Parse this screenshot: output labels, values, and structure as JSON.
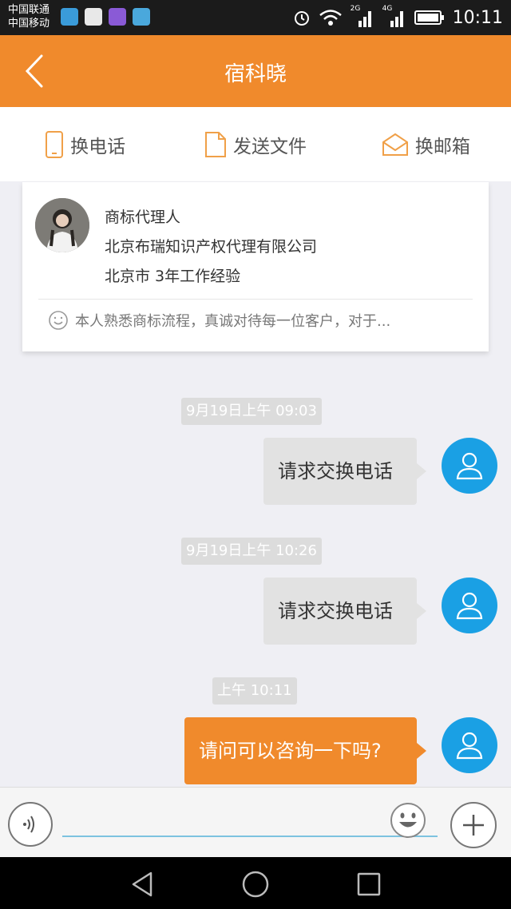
{
  "status_bar": {
    "carrier_1": "中国联通",
    "carrier_2": "中国移动",
    "net_1": "2G",
    "net_2": "4G",
    "time": "10:11"
  },
  "header": {
    "title": "宿科晓"
  },
  "actions": [
    {
      "label": "换电话",
      "icon": "phone-icon"
    },
    {
      "label": "发送文件",
      "icon": "file-icon"
    },
    {
      "label": "换邮箱",
      "icon": "envelope-icon"
    }
  ],
  "profile": {
    "title": "商标代理人",
    "company": "北京布瑞知识产权代理有限公司",
    "location_experience": "北京市 3年工作经验",
    "bio": "本人熟悉商标流程，真诚对待每一位客户，对于..."
  },
  "messages": [
    {
      "timestamp": "9月19日上午 09:03",
      "text": "请求交换电话",
      "style": "gray"
    },
    {
      "timestamp": "9月19日上午 10:26",
      "text": "请求交换电话",
      "style": "gray"
    },
    {
      "timestamp": "上午 10:11",
      "text": "请问可以咨询一下吗?",
      "style": "orange"
    }
  ],
  "input": {
    "placeholder": ""
  },
  "colors": {
    "accent": "#f08a2c",
    "avatar": "#1aa0e4",
    "bubble_gray": "#e2e2e2"
  }
}
